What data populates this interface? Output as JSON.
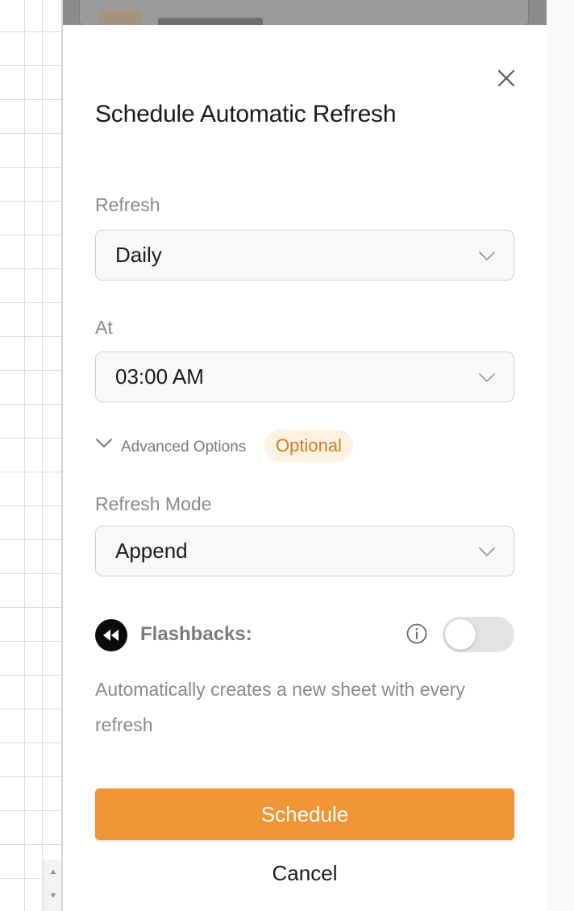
{
  "dialog": {
    "title": "Schedule Automatic Refresh",
    "close_icon": "close-icon"
  },
  "refresh": {
    "label": "Refresh",
    "value": "Daily"
  },
  "at": {
    "label": "At",
    "value": "03:00 AM"
  },
  "advanced": {
    "label": "Advanced Options",
    "badge": "Optional",
    "badge_color": "#d07a2a"
  },
  "refresh_mode": {
    "label": "Refresh Mode",
    "value": "Append"
  },
  "flashbacks": {
    "label": "Flashbacks:",
    "enabled": false,
    "description": "Automatically creates a new sheet with every refresh"
  },
  "actions": {
    "primary_label": "Schedule",
    "cancel_label": "Cancel",
    "accent": "#f09536"
  }
}
